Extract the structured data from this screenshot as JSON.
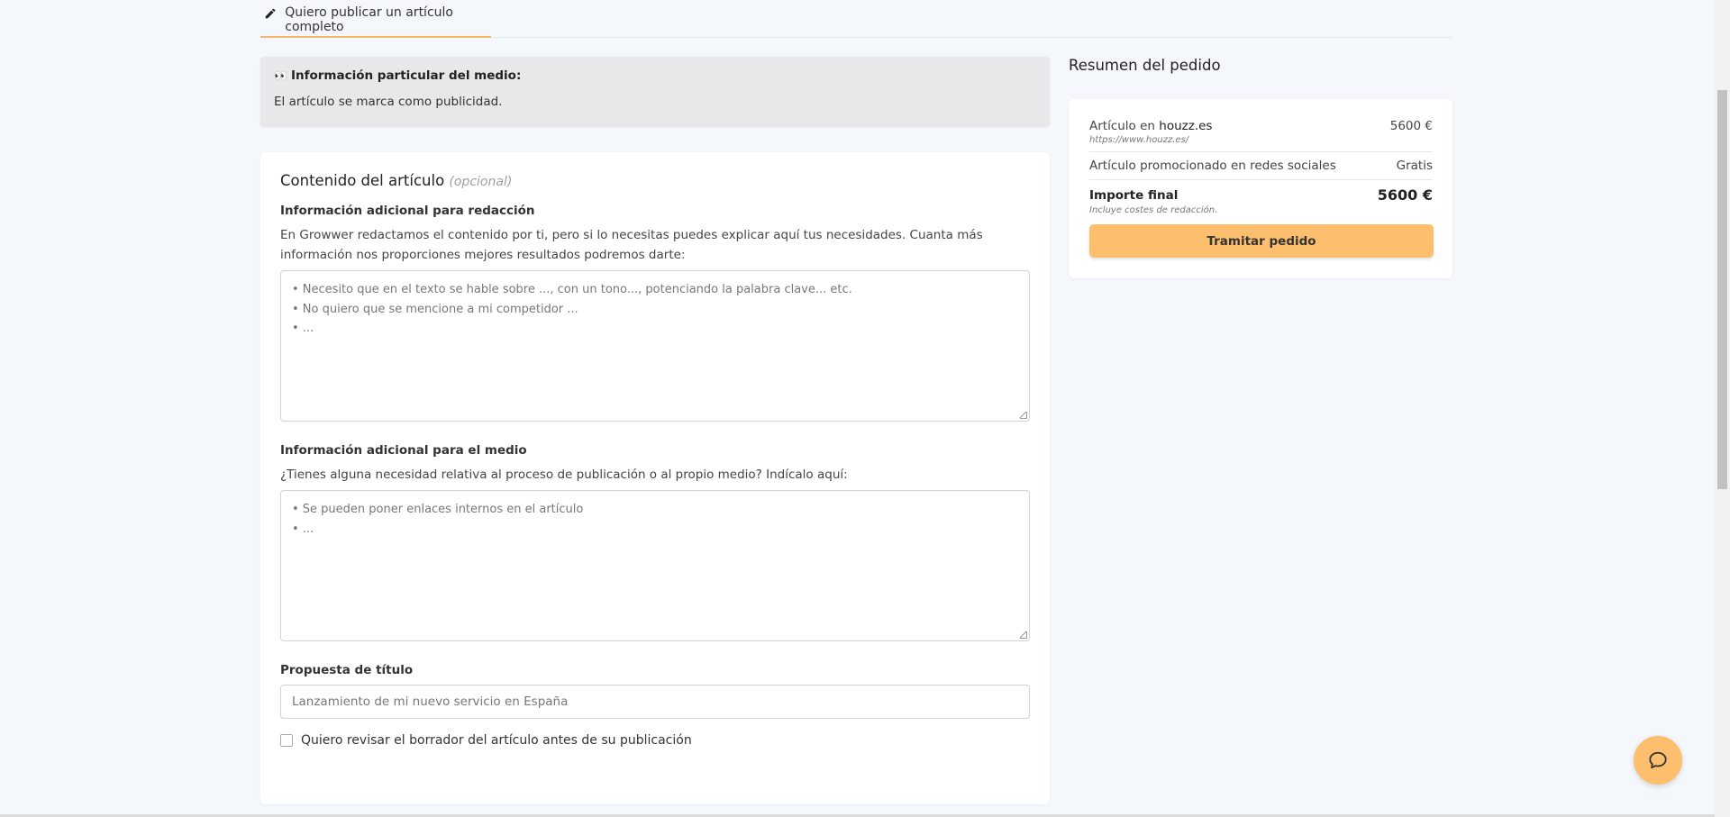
{
  "tabs": {
    "active_label": "Quiero publicar un artículo completo"
  },
  "media_info": {
    "title": "Información particular del medio:",
    "text": "El artículo se marca como publicidad."
  },
  "content": {
    "title": "Contenido del artículo",
    "optional": "(opcional)",
    "writing_info": {
      "label": "Información adicional para redacción",
      "description": "En Growwer redactamos el contenido por ti, pero si lo necesitas puedes explicar aquí tus necesidades. Cuanta más información nos proporciones mejores resultados podremos darte:",
      "placeholder_lines": [
        "• Necesito que en el texto se hable sobre ..., con un tono..., potenciando la palabra clave... etc.",
        "• No quiero que se mencione a mi competidor ...",
        "• ..."
      ]
    },
    "media_extra": {
      "label": "Información adicional para el medio",
      "description": "¿Tienes alguna necesidad relativa al proceso de publicación o al propio medio? Indícalo aquí:",
      "placeholder_lines": [
        "• Se pueden poner enlaces internos en el artículo",
        "• ..."
      ]
    },
    "title_proposal": {
      "label": "Propuesta de título",
      "placeholder": "Lanzamiento de mi nuevo servicio en España"
    },
    "review_checkbox": {
      "label": "Quiero revisar el borrador del artículo antes de su publicación",
      "checked": false
    }
  },
  "summary": {
    "title": "Resumen del pedido",
    "article_prefix": "Artículo en",
    "article_site": "houzz.es",
    "article_price": "5600 €",
    "article_url": "https://www.houzz.es/",
    "promo_label": "Artículo promocionado en redes sociales",
    "promo_price": "Gratis",
    "total_label": "Importe final",
    "total_value": "5600 €",
    "total_note": "Incluye costes de redacción.",
    "submit_label": "Tramitar pedido"
  },
  "colors": {
    "accent": "#fdbe6d",
    "tab_underline": "#f5b86a",
    "background": "#f4f8fc"
  },
  "icons": {
    "tab": "pencil-icon",
    "info": "eyes-icon",
    "chat": "chat-bubble-icon"
  }
}
